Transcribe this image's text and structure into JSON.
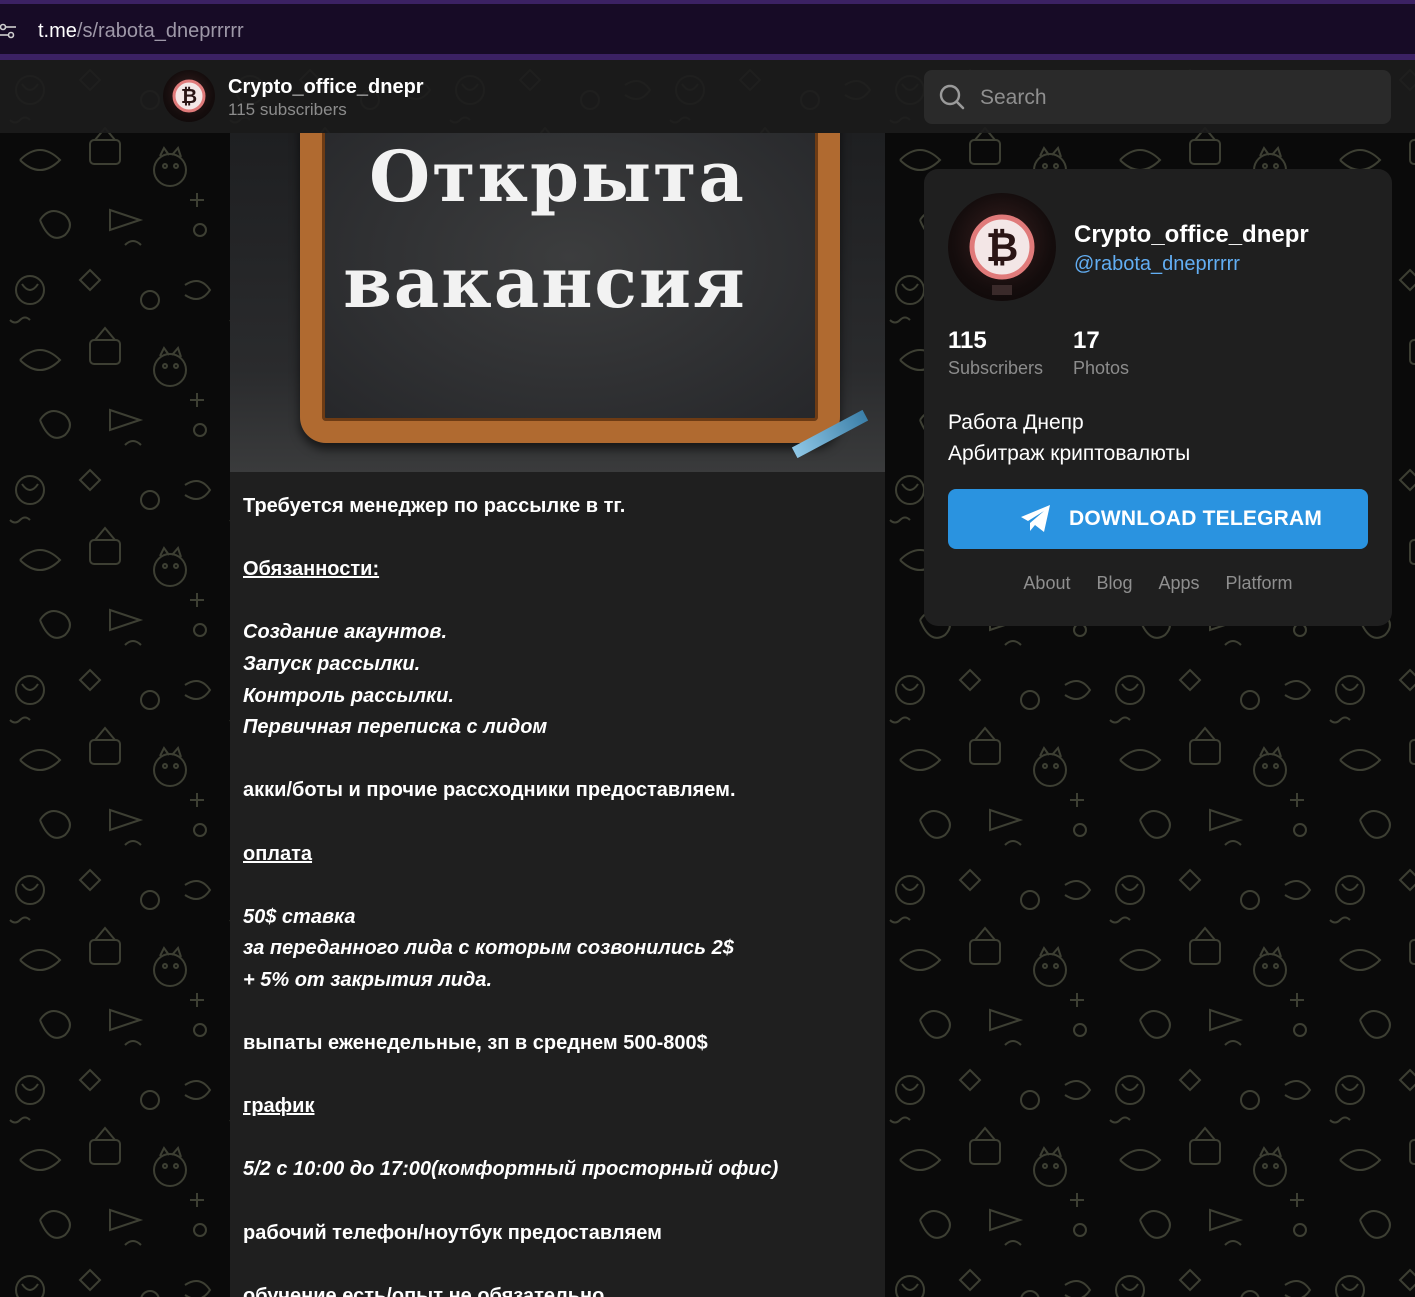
{
  "browser": {
    "url_host": "t.me",
    "url_path": "/s/rabota_dneprrrrr"
  },
  "header": {
    "channel_name": "Crypto_office_dnepr",
    "subscribers_text": "115 subscribers",
    "search_placeholder": "Search"
  },
  "post": {
    "image": {
      "line1": "Открыта",
      "line2": "вакансия"
    },
    "lines": [
      {
        "text": "Требуется менеджер по рассылке в тг.",
        "style": "b"
      },
      {
        "text": "",
        "style": "gap"
      },
      {
        "text": "Обязанности:",
        "style": "u"
      },
      {
        "text": "",
        "style": "gap"
      },
      {
        "text": "Создание акаунтов.",
        "style": "bi"
      },
      {
        "text": "Запуск рассылки.",
        "style": "bi"
      },
      {
        "text": "Контроль рассылки.",
        "style": "bi"
      },
      {
        "text": "Первичная переписка с лидом",
        "style": "bi"
      },
      {
        "text": "",
        "style": "gap"
      },
      {
        "text": "акки/боты и прочие рассходники предоставляем.",
        "style": "b"
      },
      {
        "text": "",
        "style": "gap"
      },
      {
        "text": "оплата",
        "style": "u"
      },
      {
        "text": "",
        "style": "gap"
      },
      {
        "text": "50$ ставка",
        "style": "bi"
      },
      {
        "text": "за переданного лида с которым созвонились 2$",
        "style": "bi"
      },
      {
        "text": "+ 5% от закрытия лида.",
        "style": "bi"
      },
      {
        "text": "",
        "style": "gap"
      },
      {
        "text": "выпаты еженедельные, зп в среднем 500-800$",
        "style": "b"
      },
      {
        "text": "",
        "style": "gap"
      },
      {
        "text": "график",
        "style": "u"
      },
      {
        "text": "",
        "style": "gap"
      },
      {
        "text": "5/2 с 10:00 до 17:00(комфортный просторный офис)",
        "style": "bi"
      },
      {
        "text": "",
        "style": "gap"
      },
      {
        "text": "рабочий телефон/ноутбук предоставляем",
        "style": "b"
      },
      {
        "text": "",
        "style": "gap"
      },
      {
        "text": "обучение есть/опыт не обязательно",
        "style": "b"
      }
    ]
  },
  "card": {
    "title": "Crypto_office_dnepr",
    "handle": "@rabota_dneprrrrr",
    "stats": [
      {
        "value": "115",
        "label": "Subscribers"
      },
      {
        "value": "17",
        "label": "Photos"
      }
    ],
    "description_line1": "Работа Днепр",
    "description_line2": "Арбитраж криптовалюты",
    "download_label": "DOWNLOAD TELEGRAM",
    "footer_links": [
      "About",
      "Blog",
      "Apps",
      "Platform"
    ]
  },
  "colors": {
    "accent_button": "#2a93e0",
    "link": "#62aef3",
    "panel": "#1f1f1f",
    "browser_bar": "#170b26"
  }
}
